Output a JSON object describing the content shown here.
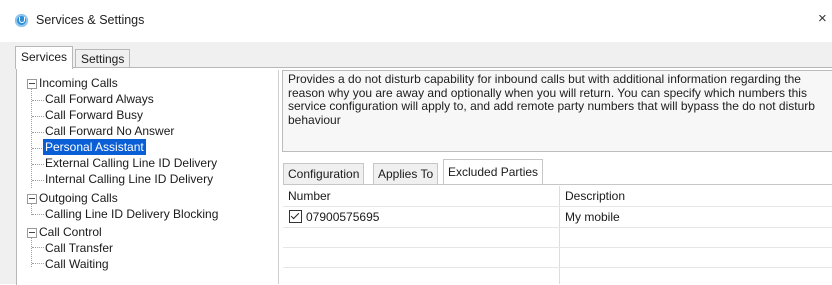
{
  "window": {
    "title": "Services & Settings",
    "close_glyph": "×",
    "icon": "app-logo-icon"
  },
  "tabs": [
    {
      "label": "Services",
      "active": true
    },
    {
      "label": "Settings",
      "active": false
    }
  ],
  "tree": {
    "incoming": {
      "label": "Incoming Calls",
      "children": [
        "Call Forward Always",
        "Call Forward Busy",
        "Call Forward No Answer",
        "Personal Assistant",
        "External Calling Line ID Delivery",
        "Internal Calling Line ID Delivery"
      ],
      "selected": "Personal Assistant"
    },
    "outgoing": {
      "label": "Outgoing Calls",
      "children": [
        "Calling Line ID Delivery Blocking"
      ]
    },
    "control": {
      "label": "Call Control",
      "children": [
        "Call Transfer",
        "Call Waiting"
      ]
    }
  },
  "description": "Provides a do not disturb capability for inbound calls but with additional information regarding the reason why you are away and optionally when you will return. You can specify which numbers this service configuration will apply to, and add remote party numbers that will bypass the do not disturb behaviour",
  "subtabs": [
    {
      "label": "Configuration",
      "active": false
    },
    {
      "label": "Applies To",
      "active": false
    },
    {
      "label": "Excluded Parties",
      "active": true
    }
  ],
  "grid": {
    "columns": {
      "number": "Number",
      "description": "Description"
    },
    "rows": [
      {
        "checked": true,
        "number": "07900575695",
        "description": "My mobile"
      }
    ]
  },
  "colors": {
    "selection": "#0a5fd6",
    "app_icon": "#2e8fd6"
  }
}
